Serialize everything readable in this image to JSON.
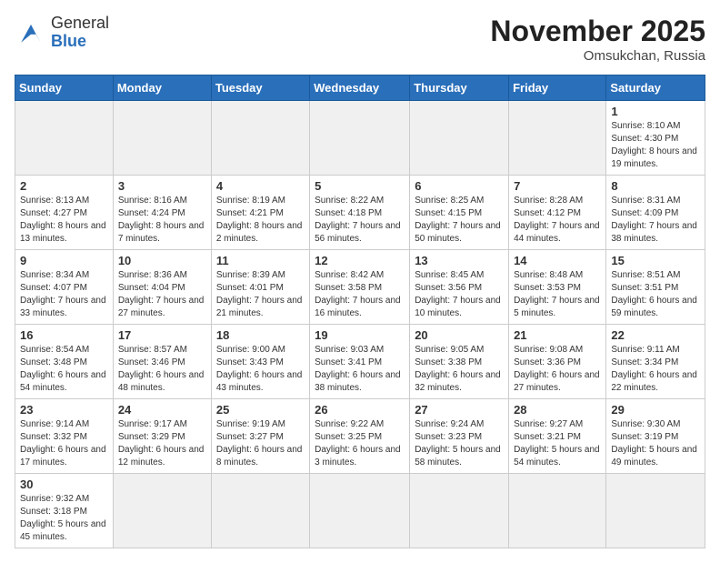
{
  "header": {
    "logo_general": "General",
    "logo_blue": "Blue",
    "month_title": "November 2025",
    "location": "Omsukchan, Russia"
  },
  "weekdays": [
    "Sunday",
    "Monday",
    "Tuesday",
    "Wednesday",
    "Thursday",
    "Friday",
    "Saturday"
  ],
  "weeks": [
    [
      {
        "day": "",
        "empty": true
      },
      {
        "day": "",
        "empty": true
      },
      {
        "day": "",
        "empty": true
      },
      {
        "day": "",
        "empty": true
      },
      {
        "day": "",
        "empty": true
      },
      {
        "day": "",
        "empty": true
      },
      {
        "day": "1",
        "info": "Sunrise: 8:10 AM\nSunset: 4:30 PM\nDaylight: 8 hours\nand 19 minutes."
      }
    ],
    [
      {
        "day": "2",
        "info": "Sunrise: 8:13 AM\nSunset: 4:27 PM\nDaylight: 8 hours\nand 13 minutes."
      },
      {
        "day": "3",
        "info": "Sunrise: 8:16 AM\nSunset: 4:24 PM\nDaylight: 8 hours\nand 7 minutes."
      },
      {
        "day": "4",
        "info": "Sunrise: 8:19 AM\nSunset: 4:21 PM\nDaylight: 8 hours\nand 2 minutes."
      },
      {
        "day": "5",
        "info": "Sunrise: 8:22 AM\nSunset: 4:18 PM\nDaylight: 7 hours\nand 56 minutes."
      },
      {
        "day": "6",
        "info": "Sunrise: 8:25 AM\nSunset: 4:15 PM\nDaylight: 7 hours\nand 50 minutes."
      },
      {
        "day": "7",
        "info": "Sunrise: 8:28 AM\nSunset: 4:12 PM\nDaylight: 7 hours\nand 44 minutes."
      },
      {
        "day": "8",
        "info": "Sunrise: 8:31 AM\nSunset: 4:09 PM\nDaylight: 7 hours\nand 38 minutes."
      }
    ],
    [
      {
        "day": "9",
        "info": "Sunrise: 8:34 AM\nSunset: 4:07 PM\nDaylight: 7 hours\nand 33 minutes."
      },
      {
        "day": "10",
        "info": "Sunrise: 8:36 AM\nSunset: 4:04 PM\nDaylight: 7 hours\nand 27 minutes."
      },
      {
        "day": "11",
        "info": "Sunrise: 8:39 AM\nSunset: 4:01 PM\nDaylight: 7 hours\nand 21 minutes."
      },
      {
        "day": "12",
        "info": "Sunrise: 8:42 AM\nSunset: 3:58 PM\nDaylight: 7 hours\nand 16 minutes."
      },
      {
        "day": "13",
        "info": "Sunrise: 8:45 AM\nSunset: 3:56 PM\nDaylight: 7 hours\nand 10 minutes."
      },
      {
        "day": "14",
        "info": "Sunrise: 8:48 AM\nSunset: 3:53 PM\nDaylight: 7 hours\nand 5 minutes."
      },
      {
        "day": "15",
        "info": "Sunrise: 8:51 AM\nSunset: 3:51 PM\nDaylight: 6 hours\nand 59 minutes."
      }
    ],
    [
      {
        "day": "16",
        "info": "Sunrise: 8:54 AM\nSunset: 3:48 PM\nDaylight: 6 hours\nand 54 minutes."
      },
      {
        "day": "17",
        "info": "Sunrise: 8:57 AM\nSunset: 3:46 PM\nDaylight: 6 hours\nand 48 minutes."
      },
      {
        "day": "18",
        "info": "Sunrise: 9:00 AM\nSunset: 3:43 PM\nDaylight: 6 hours\nand 43 minutes."
      },
      {
        "day": "19",
        "info": "Sunrise: 9:03 AM\nSunset: 3:41 PM\nDaylight: 6 hours\nand 38 minutes."
      },
      {
        "day": "20",
        "info": "Sunrise: 9:05 AM\nSunset: 3:38 PM\nDaylight: 6 hours\nand 32 minutes."
      },
      {
        "day": "21",
        "info": "Sunrise: 9:08 AM\nSunset: 3:36 PM\nDaylight: 6 hours\nand 27 minutes."
      },
      {
        "day": "22",
        "info": "Sunrise: 9:11 AM\nSunset: 3:34 PM\nDaylight: 6 hours\nand 22 minutes."
      }
    ],
    [
      {
        "day": "23",
        "info": "Sunrise: 9:14 AM\nSunset: 3:32 PM\nDaylight: 6 hours\nand 17 minutes."
      },
      {
        "day": "24",
        "info": "Sunrise: 9:17 AM\nSunset: 3:29 PM\nDaylight: 6 hours\nand 12 minutes."
      },
      {
        "day": "25",
        "info": "Sunrise: 9:19 AM\nSunset: 3:27 PM\nDaylight: 6 hours\nand 8 minutes."
      },
      {
        "day": "26",
        "info": "Sunrise: 9:22 AM\nSunset: 3:25 PM\nDaylight: 6 hours\nand 3 minutes."
      },
      {
        "day": "27",
        "info": "Sunrise: 9:24 AM\nSunset: 3:23 PM\nDaylight: 5 hours\nand 58 minutes."
      },
      {
        "day": "28",
        "info": "Sunrise: 9:27 AM\nSunset: 3:21 PM\nDaylight: 5 hours\nand 54 minutes."
      },
      {
        "day": "29",
        "info": "Sunrise: 9:30 AM\nSunset: 3:19 PM\nDaylight: 5 hours\nand 49 minutes."
      }
    ],
    [
      {
        "day": "30",
        "info": "Sunrise: 9:32 AM\nSunset: 3:18 PM\nDaylight: 5 hours\nand 45 minutes."
      },
      {
        "day": "",
        "empty": true
      },
      {
        "day": "",
        "empty": true
      },
      {
        "day": "",
        "empty": true
      },
      {
        "day": "",
        "empty": true
      },
      {
        "day": "",
        "empty": true
      },
      {
        "day": "",
        "empty": true
      }
    ]
  ]
}
